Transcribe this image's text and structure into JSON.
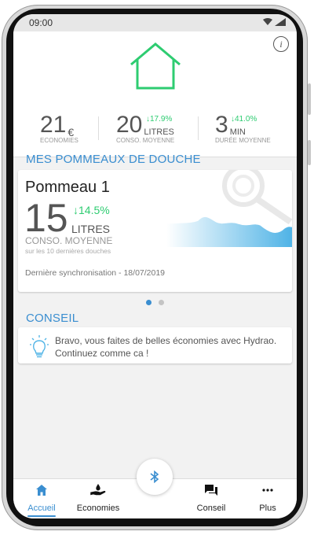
{
  "status_bar": {
    "time": "09:00",
    "network": "LTE"
  },
  "colors": {
    "accent": "#3a8ed0",
    "house": "#2ecc71",
    "positive": "#2ecc71",
    "wave": "#4fb3e6"
  },
  "stats": [
    {
      "value": "21",
      "unit": "€",
      "change": "",
      "label": "ECONOMIES"
    },
    {
      "value": "20",
      "unit": "LITRES",
      "change": "↓17.9%",
      "label": "CONSO. MOYENNE"
    },
    {
      "value": "3",
      "unit": "MIN",
      "change": "↓41.0%",
      "label": "DURÉE MOYENNE"
    }
  ],
  "section_pommeaux": "MES POMMEAUX DE DOUCHE",
  "pommeau": {
    "title": "Pommeau 1",
    "value": "15",
    "change": "↓14.5%",
    "unit": "LITRES",
    "label": "CONSO. MOYENNE",
    "sublabel": "sur les 10 dernières douches",
    "sync": "Dernière synchronisation - 18/07/2019"
  },
  "carousel": {
    "pages": 2,
    "active": 1
  },
  "section_conseil": "CONSEIL",
  "tip": {
    "line1": "Bravo, vous faites de belles économies avec Hydrao.",
    "line2": "Continuez comme ca !"
  },
  "nav": [
    {
      "label": "Accueil",
      "icon": "home-icon",
      "active": true
    },
    {
      "label": "Economies",
      "icon": "water-hand-icon",
      "active": false
    },
    {
      "label": "Conseil",
      "icon": "chat-icon",
      "active": false
    },
    {
      "label": "Plus",
      "icon": "more-icon",
      "active": false
    }
  ],
  "center_button_icon": "bluetooth-icon"
}
